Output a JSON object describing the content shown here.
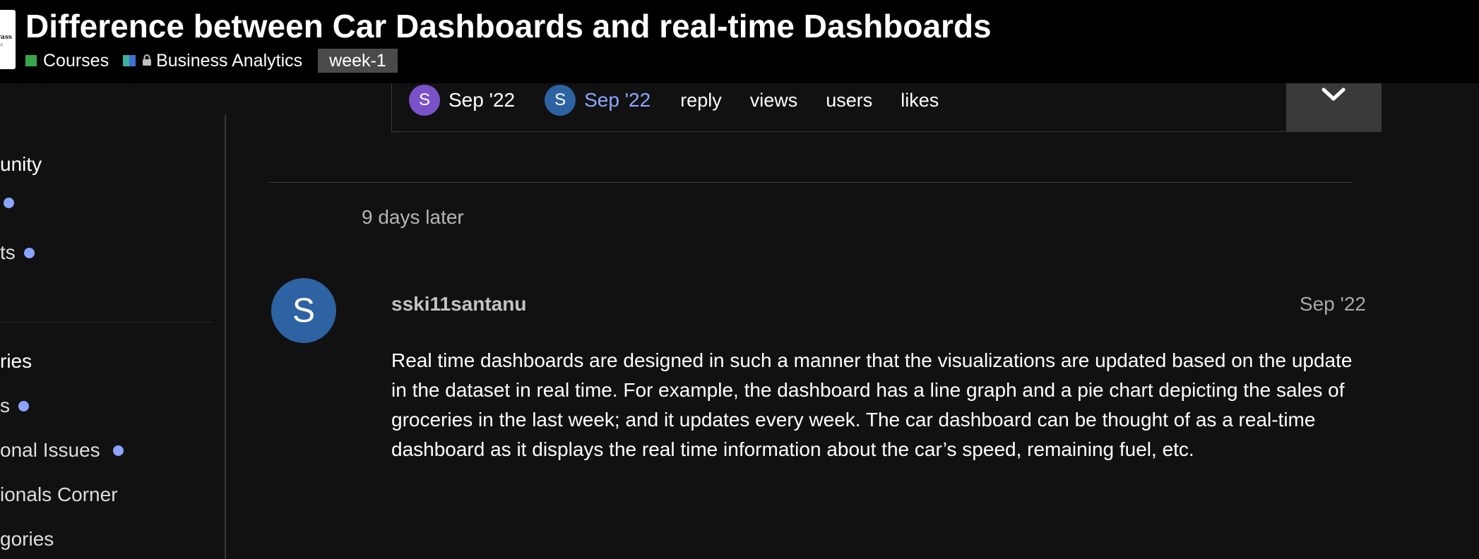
{
  "header": {
    "logo_text": "drass",
    "logo_subtext": "tras",
    "title": "Difference between Car Dashboards and real-time Dashboards",
    "breadcrumbs": [
      {
        "label": "Courses",
        "color": "#3aa64a"
      },
      {
        "label": "Business Analytics",
        "colors": [
          "#3ab0a0",
          "#3f6fd2"
        ],
        "locked": true
      }
    ],
    "tag": "week-1"
  },
  "sidebar": {
    "items": [
      {
        "label": "unity",
        "is_heading": true
      },
      {
        "label": "",
        "dot": true
      },
      {
        "label": "ts",
        "dot": true
      },
      {
        "label": "ries",
        "is_heading": true
      },
      {
        "label": "s",
        "dot": true
      },
      {
        "label": "onal Issues",
        "dot": true
      },
      {
        "label": "ionals Corner"
      },
      {
        "label": "gories"
      }
    ]
  },
  "summary": {
    "created_avatar_letter": "S",
    "created_date": "Sep '22",
    "last_avatar_letter": "S",
    "last_date": "Sep '22",
    "labels": [
      "reply",
      "views",
      "users",
      "likes"
    ],
    "expand_icon": "chevron-down-icon"
  },
  "timeline": {
    "gap_note": "9 days later"
  },
  "post": {
    "avatar_letter": "S",
    "avatar_color": "#2d62a3",
    "username": "sski11santanu",
    "date": "Sep '22",
    "body": "Real time dashboards are designed in such a manner that the visualizations are updated based on the update in the dataset in real time. For example, the dashboard has a line graph and a pie chart depicting the sales of groceries in the last week; and it updates every week. The car dashboard can be thought of as a real-time dashboard as it displays the real time information about the car’s speed, remaining fuel, etc."
  },
  "colors": {
    "background": "#111111",
    "header_bg": "#000000",
    "link": "#8aa8ff",
    "unread_dot": "#8aa4ff",
    "avatar_purple": "#7b52c9",
    "avatar_blue": "#2d62a3"
  }
}
